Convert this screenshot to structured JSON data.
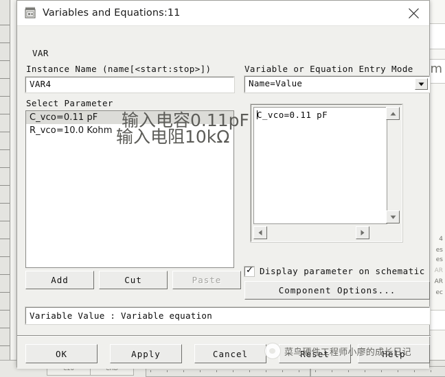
{
  "window": {
    "title": "Variables and Equations:11",
    "icon": "variables-equations-icon",
    "close_label": "✕"
  },
  "left_panel": {
    "var_label": "VAR",
    "instance_name_label": "Instance Name  (name[<start:stop>])",
    "instance_name_value": "VAR4",
    "select_parameter_label": "Select Parameter",
    "parameters": [
      {
        "text": "C_vco=0.11 pF",
        "selected": true,
        "annotation": "输入电容0.11pF"
      },
      {
        "text": "R_vco=10.0 Kohm",
        "selected": false,
        "annotation": "输入电阻10kΩ"
      }
    ],
    "buttons": [
      {
        "label": "Add",
        "enabled": true
      },
      {
        "label": "Cut",
        "enabled": true
      },
      {
        "label": "Paste",
        "enabled": false
      }
    ]
  },
  "right_panel": {
    "entry_mode_label": "Variable or Equation Entry Mode",
    "entry_mode_value": "Name=Value",
    "entry_mode_options": [
      "Name=Value"
    ],
    "editor_value": "C_vco=0.11 pF",
    "checkbox_label": "Display parameter on schematic",
    "checkbox_checked": true,
    "component_options_label": "Component Options..."
  },
  "status_bar": {
    "value": "Variable Value : Variable equation"
  },
  "footer": {
    "buttons": [
      {
        "label": "OK"
      },
      {
        "label": "Apply"
      },
      {
        "label": "Cancel"
      },
      {
        "label": "Reset"
      },
      {
        "label": "Help"
      }
    ]
  },
  "watermark": {
    "text": "菜鸟硬件工程师小廖的成长日记"
  },
  "background": {
    "bottom_cells": [
      "C20",
      "CHD"
    ],
    "right_glyphs": [
      "4",
      "es",
      "es",
      "AR",
      "AR",
      "ec"
    ]
  },
  "colors": {
    "dialog_face": "#f0f0ed",
    "titlebar": "#ffffff",
    "field_white": "#ffffff",
    "selection": "#dcdcd8",
    "text": "#101010",
    "disabled_text": "#a5a5a1",
    "annotation": "#5c5c58"
  }
}
